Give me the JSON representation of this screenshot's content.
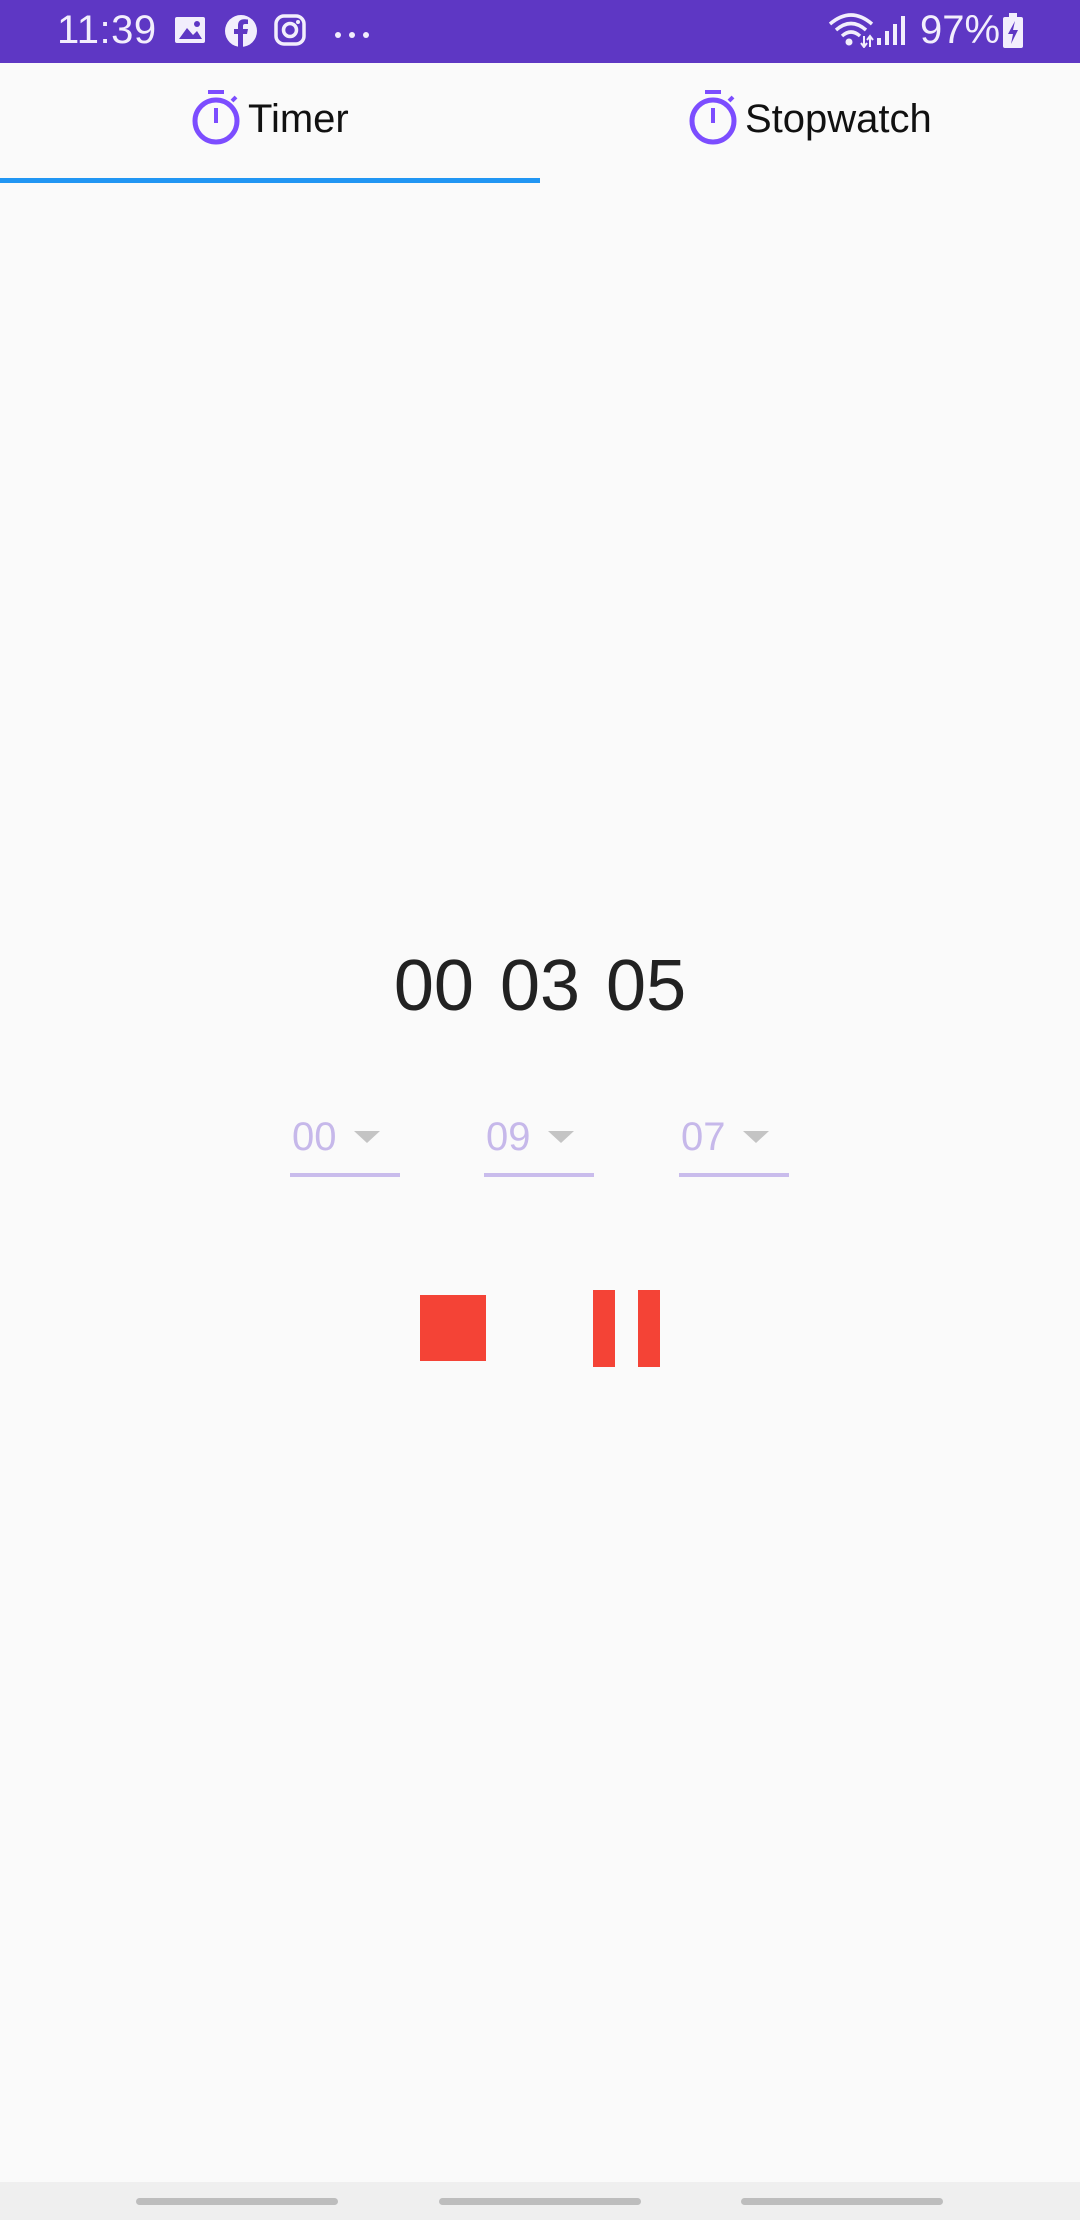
{
  "status_bar": {
    "time": "11:39",
    "battery": "97%",
    "background_color": "#5e37c4",
    "icons": [
      "gallery-icon",
      "facebook-icon",
      "instagram-icon",
      "more-dots-icon",
      "wifi-icon",
      "signal-icon",
      "battery-charging-icon"
    ]
  },
  "tabs": [
    {
      "label": "Timer",
      "icon": "stopwatch-icon",
      "selected": true
    },
    {
      "label": "Stopwatch",
      "icon": "stopwatch-icon",
      "selected": false
    }
  ],
  "colors": {
    "accent": "#7c4dff",
    "indicator": "#2196f3",
    "control": "#f44336",
    "dropdown_text": "#c6b8ea"
  },
  "timer": {
    "display": "00 03 05"
  },
  "dropdowns": {
    "hours": "00",
    "minutes": "09",
    "seconds": "07"
  },
  "controls": {
    "stop_icon": "stop-icon",
    "pause_icon": "pause-icon"
  }
}
